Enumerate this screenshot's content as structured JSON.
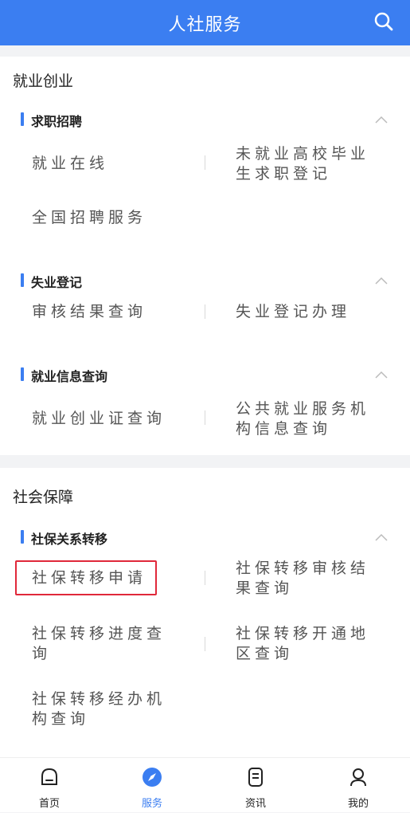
{
  "header": {
    "title": "人社服务"
  },
  "colors": {
    "accent": "#3b7ef1",
    "highlight": "#e0283a"
  },
  "employment": {
    "title": "就业创业",
    "sections": [
      {
        "label": "求职招聘",
        "items": [
          "就业在线",
          "未就业高校毕业生求职登记",
          "全国招聘服务"
        ]
      },
      {
        "label": "失业登记",
        "items": [
          "审核结果查询",
          "失业登记办理"
        ]
      },
      {
        "label": "就业信息查询",
        "items": [
          "就业创业证查询",
          "公共就业服务机构信息查询"
        ]
      }
    ]
  },
  "social": {
    "title": "社会保障",
    "sections": [
      {
        "label": "社保关系转移",
        "items": [
          "社保转移申请",
          "社保转移审核结果查询",
          "社保转移进度查询",
          "社保转移开通地区查询",
          "社保转移经办机构查询"
        ]
      }
    ]
  },
  "tabbar": [
    {
      "label": "首页",
      "icon": "home-icon",
      "active": false
    },
    {
      "label": "服务",
      "icon": "compass-icon",
      "active": true
    },
    {
      "label": "资讯",
      "icon": "news-icon",
      "active": false
    },
    {
      "label": "我的",
      "icon": "user-icon",
      "active": false
    }
  ]
}
